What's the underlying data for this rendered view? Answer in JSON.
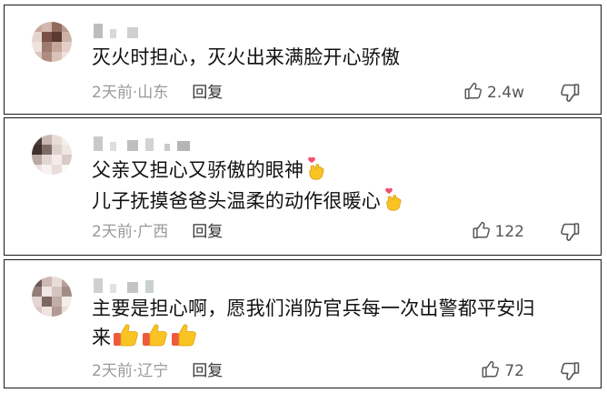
{
  "comments": [
    {
      "text_lines": [
        "灭火时担心，灭火出来满脸开心骄傲"
      ],
      "trailing_emoji": [
        [],
        []
      ],
      "time": "2天前",
      "separator": "·",
      "location": "山东",
      "reply_label": "回复",
      "likes": "2.4w",
      "avatar_colors": [
        "#c9a79a",
        "#d3b8ad",
        "#8f6b5e",
        "#b89a8f",
        "#e6d5cf",
        "#7a5148",
        "#5a3b33",
        "#cdb1a6",
        "#f0e3de",
        "#9c7b70",
        "#c6a699",
        "#e4cfc7",
        "#dcc6bd",
        "#b08c80",
        "#d9c2b8",
        "#efe1dc"
      ],
      "name_blocks": [
        "#bdbdbd",
        "#d8d8d8",
        "#cfcfcf"
      ]
    },
    {
      "text_lines": [
        "父亲又担心又骄傲的眼神",
        "儿子抚摸爸爸头温柔的动作很暖心"
      ],
      "trailing_emoji": [
        [
          "finger-heart"
        ],
        [
          "finger-heart"
        ]
      ],
      "time": "2天前",
      "separator": "·",
      "location": "广西",
      "reply_label": "回复",
      "likes": "122",
      "avatar_colors": [
        "#4b3b3a",
        "#c8b7b3",
        "#e9dcd7",
        "#f5eeec",
        "#3e2f2d",
        "#7f6a66",
        "#dcd0cc",
        "#efe6e4",
        "#b9a8a4",
        "#e2d6d2",
        "#f3ecea",
        "#d8c9c4",
        "#ece3e0",
        "#f7f2f0",
        "#e8ddd9",
        "#faf6f5"
      ],
      "name_blocks": [
        "#c9c9c9",
        "#dedede",
        "#bfbfbf",
        "#d3d3d3",
        "#cacaca",
        "#b5b5b5"
      ]
    },
    {
      "text_lines": [
        "主要是担心啊，愿我们消防官兵每一次出警都平安归",
        "来"
      ],
      "trailing_emoji": [
        [],
        [
          "thumbs-up",
          "thumbs-up",
          "thumbs-up"
        ]
      ],
      "time": "2天前",
      "separator": "·",
      "location": "辽宁",
      "reply_label": "回复",
      "likes": "72",
      "avatar_colors": [
        "#6b5a57",
        "#cdb8b2",
        "#e8dcd8",
        "#b7a19b",
        "#927d78",
        "#f1e7e4",
        "#d6c4bf",
        "#a48c86",
        "#e3d5d1",
        "#7d6762",
        "#c2ada7",
        "#f4ede9",
        "#d9cac5",
        "#efe4e0",
        "#b29b95",
        "#e9dfdb"
      ],
      "name_blocks": [
        "#d0d0d0",
        "#e2e2e2",
        "#c4c4c4",
        "#cbd1cf"
      ]
    }
  ]
}
